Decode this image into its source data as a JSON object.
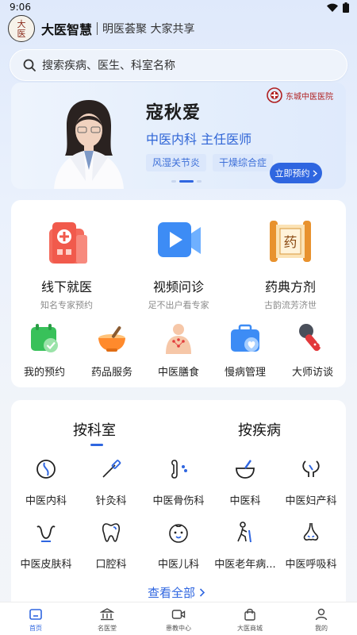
{
  "status": {
    "time": "9:06"
  },
  "header": {
    "brand": "大医智慧",
    "slogan": "明医荟聚 大家共享",
    "logo_text": "大医"
  },
  "search": {
    "placeholder": "搜索疾病、医生、科室名称"
  },
  "banner": {
    "doctor_name": "寇秋爱",
    "doctor_title": "中医内科 主任医师",
    "tags": [
      "风湿关节炎",
      "干燥综合症"
    ],
    "hospital": "东城中医医院",
    "button_label": "立即预约",
    "page_count": 3,
    "active_page": 1
  },
  "services": {
    "main": [
      {
        "title": "线下就医",
        "subtitle": "知名专家预约",
        "icon": "hospital-icon"
      },
      {
        "title": "视频问诊",
        "subtitle": "足不出户看专家",
        "icon": "video-icon"
      },
      {
        "title": "药典方剂",
        "subtitle": "古韵流芳济世",
        "icon": "scroll-icon",
        "icon_char": "药"
      }
    ],
    "secondary": [
      {
        "title": "我的预约",
        "icon": "calendar-check-icon"
      },
      {
        "title": "药品服务",
        "icon": "mortar-bowl-icon"
      },
      {
        "title": "中医膳食",
        "icon": "acupoint-body-icon"
      },
      {
        "title": "慢病管理",
        "icon": "medical-kit-icon"
      },
      {
        "title": "大师访谈",
        "icon": "microphone-icon"
      }
    ]
  },
  "departments": {
    "tabs": [
      "按科室",
      "按疾病"
    ],
    "active_tab": 0,
    "items": [
      {
        "label": "中医内科",
        "icon": "stomach-icon"
      },
      {
        "label": "针灸科",
        "icon": "acupuncture-needle-icon"
      },
      {
        "label": "中医骨伤科",
        "icon": "bone-icon"
      },
      {
        "label": "中医科",
        "icon": "mortar-icon"
      },
      {
        "label": "中医妇产科",
        "icon": "uterus-icon"
      },
      {
        "label": "中医皮肤科",
        "icon": "skin-icon"
      },
      {
        "label": "口腔科",
        "icon": "tooth-icon"
      },
      {
        "label": "中医儿科",
        "icon": "baby-icon"
      },
      {
        "label": "中医老年病...",
        "icon": "elderly-icon"
      },
      {
        "label": "中医呼吸科",
        "icon": "nose-icon"
      }
    ],
    "view_all": "查看全部"
  },
  "tabbar": {
    "items": [
      {
        "label": "首页",
        "icon": "home-icon"
      },
      {
        "label": "名医堂",
        "icon": "hall-icon"
      },
      {
        "label": "患教中心",
        "icon": "video-camera-icon"
      },
      {
        "label": "大医商城",
        "icon": "shopping-bag-icon"
      },
      {
        "label": "我的",
        "icon": "user-icon"
      }
    ],
    "active": 0
  },
  "colors": {
    "accent": "#2f66e0",
    "hospital_red": "#b02020"
  }
}
